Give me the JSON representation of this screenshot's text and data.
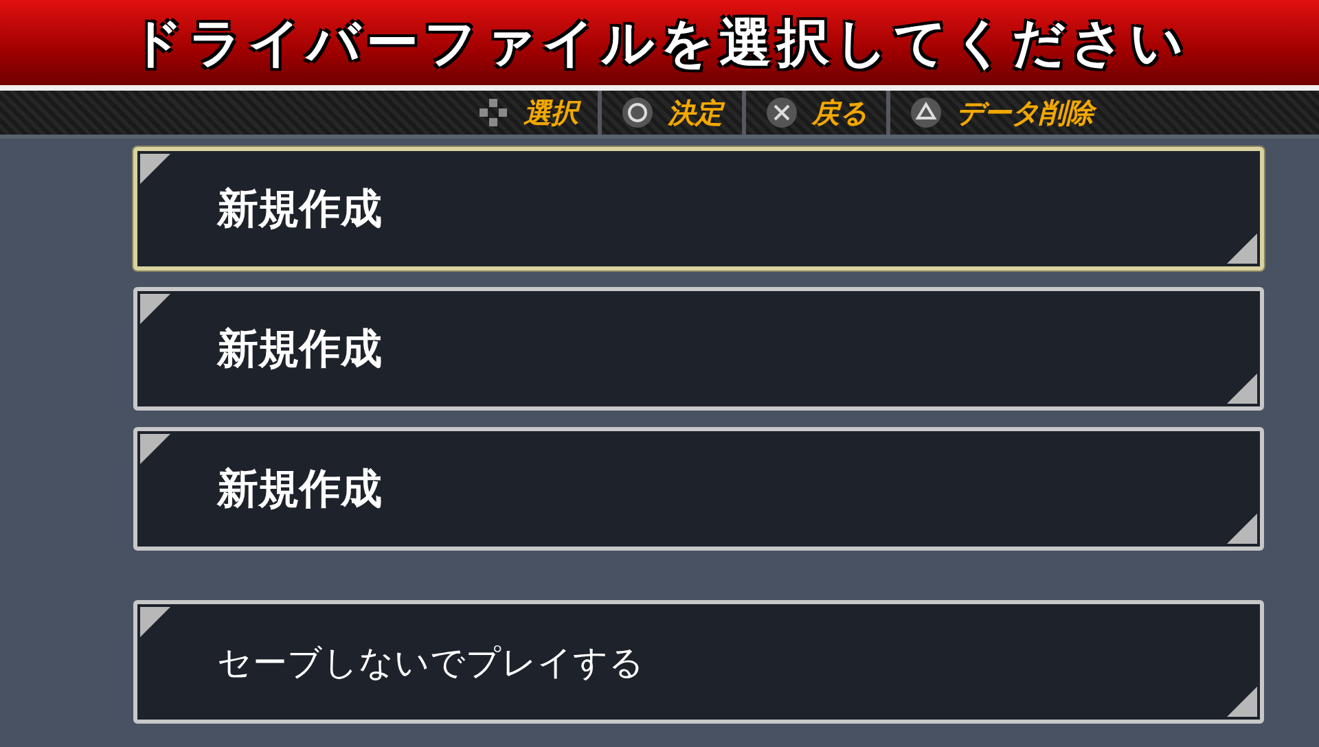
{
  "title": "ドライバーファイルを選択してください",
  "hints": [
    {
      "kind": "dpad",
      "label": "選択"
    },
    {
      "kind": "circle",
      "label": "決定"
    },
    {
      "kind": "cross",
      "label": "戻る"
    },
    {
      "kind": "triangle",
      "label": "データ削除"
    }
  ],
  "slots": [
    {
      "kind": "file",
      "label": "新規作成",
      "selected": true
    },
    {
      "kind": "file",
      "label": "新規作成",
      "selected": false
    },
    {
      "kind": "file",
      "label": "新規作成",
      "selected": false
    },
    {
      "kind": "option",
      "label": "セーブしないでプレイする",
      "selected": false
    }
  ]
}
